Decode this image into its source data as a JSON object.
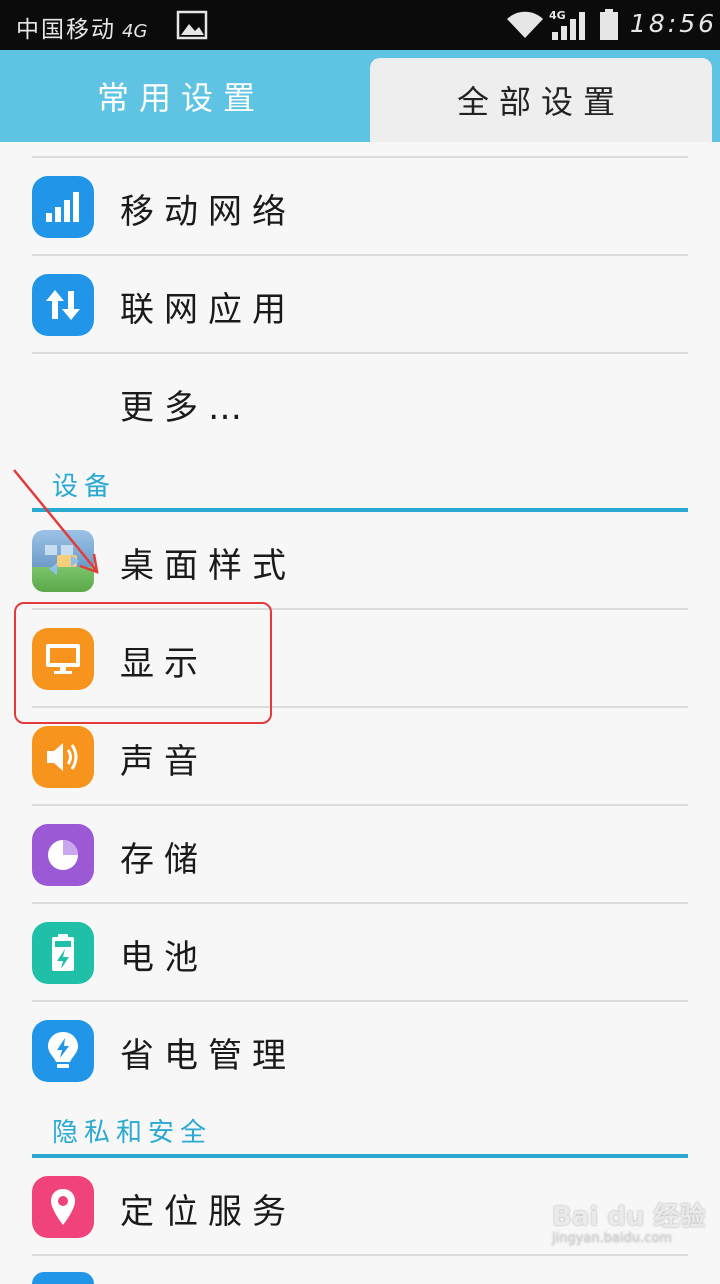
{
  "status_bar": {
    "carrier": "中国移动",
    "network": "4G",
    "signal_network": "4G",
    "time": "18:56"
  },
  "tabs": [
    {
      "label": "常用设置",
      "active": false
    },
    {
      "label": "全部设置",
      "active": true
    }
  ],
  "sections": [
    {
      "title": "设备"
    },
    {
      "title": "隐私和安全"
    }
  ],
  "items": [
    {
      "label": "移动网络",
      "icon": "signal-bars-icon",
      "color": "#2196e8"
    },
    {
      "label": "联网应用",
      "icon": "data-transfer-icon",
      "color": "#2196e8"
    },
    {
      "label": "更多…",
      "icon": "none"
    },
    {
      "label": "桌面样式",
      "icon": "desktop-style-icon",
      "color": "#8fb5d8"
    },
    {
      "label": "显示",
      "icon": "monitor-icon",
      "color": "#f7941d"
    },
    {
      "label": "声音",
      "icon": "speaker-icon",
      "color": "#f7941d"
    },
    {
      "label": "存储",
      "icon": "pie-storage-icon",
      "color": "#9b59d6"
    },
    {
      "label": "电池",
      "icon": "battery-icon",
      "color": "#20c0a8"
    },
    {
      "label": "省电管理",
      "icon": "bulb-icon",
      "color": "#2196e8"
    },
    {
      "label": "定位服务",
      "icon": "location-pin-icon",
      "color": "#f0437a"
    }
  ],
  "watermark": {
    "main": "Bai du 经验",
    "sub": "jingyan.baidu.com"
  },
  "colors": {
    "accent": "#2aa9d2",
    "tabbar": "#5fc3e4",
    "annotation": "#e23b3b"
  }
}
